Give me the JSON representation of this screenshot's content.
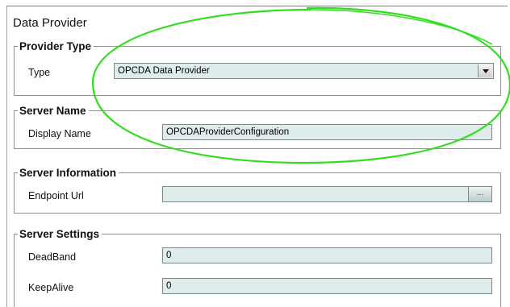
{
  "page": {
    "title": "Data Provider"
  },
  "provider_type": {
    "legend": "Provider Type",
    "type_label": "Type",
    "type_value": "OPCDA Data Provider"
  },
  "server_name": {
    "legend": "Server Name",
    "display_name_label": "Display Name",
    "display_name_value": "OPCDAProviderConfiguration"
  },
  "server_information": {
    "legend": "Server Information",
    "endpoint_label": "Endpoint Url",
    "endpoint_value": "",
    "browse_label": "..."
  },
  "server_settings": {
    "legend": "Server Settings",
    "deadband_label": "DeadBand",
    "deadband_value": "0",
    "keepalive_label": "KeepAlive",
    "keepalive_value": "0"
  },
  "colors": {
    "field_bg": "#dfecec",
    "annotation": "#33dd22"
  },
  "icons": {
    "dropdown": "chevron-down-icon",
    "browse": "ellipsis-icon"
  }
}
